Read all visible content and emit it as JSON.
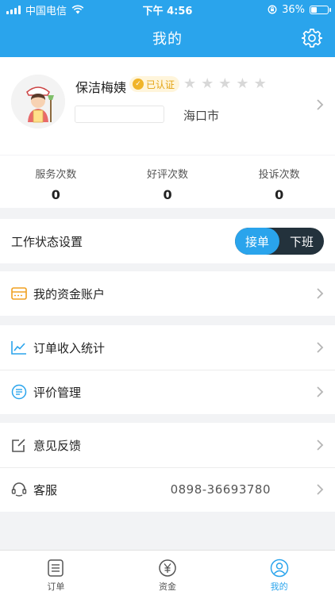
{
  "status_bar": {
    "carrier": "中国电信",
    "time": "下午 4:56",
    "battery": "36%",
    "battery_level": 0.36
  },
  "nav": {
    "title": "我的",
    "settings_icon": "gear-icon"
  },
  "profile": {
    "name": "保洁梅姨",
    "badge": "已认证",
    "rating": {
      "filled": 0,
      "total": 5
    },
    "city": "海口市"
  },
  "stats": [
    {
      "label": "服务次数",
      "value": "0"
    },
    {
      "label": "好评次数",
      "value": "0"
    },
    {
      "label": "投诉次数",
      "value": "0"
    }
  ],
  "work_status": {
    "label": "工作状态设置",
    "on_label": "接单",
    "off_label": "下班",
    "active": "接单"
  },
  "menu": {
    "account": "我的资金账户",
    "income": "订单收入统计",
    "reviews": "评价管理",
    "feedback": "意见反馈",
    "service": "客服",
    "service_phone": "0898-36693780"
  },
  "tabs": [
    {
      "label": "订单",
      "icon": "order-icon"
    },
    {
      "label": "资金",
      "icon": "money-icon"
    },
    {
      "label": "我的",
      "icon": "profile-icon",
      "active": true
    }
  ],
  "colors": {
    "primary": "#2aa4ec",
    "toggle_bg": "#23323c",
    "badge": "#f0b429",
    "page_bg": "#f2f3f5"
  }
}
